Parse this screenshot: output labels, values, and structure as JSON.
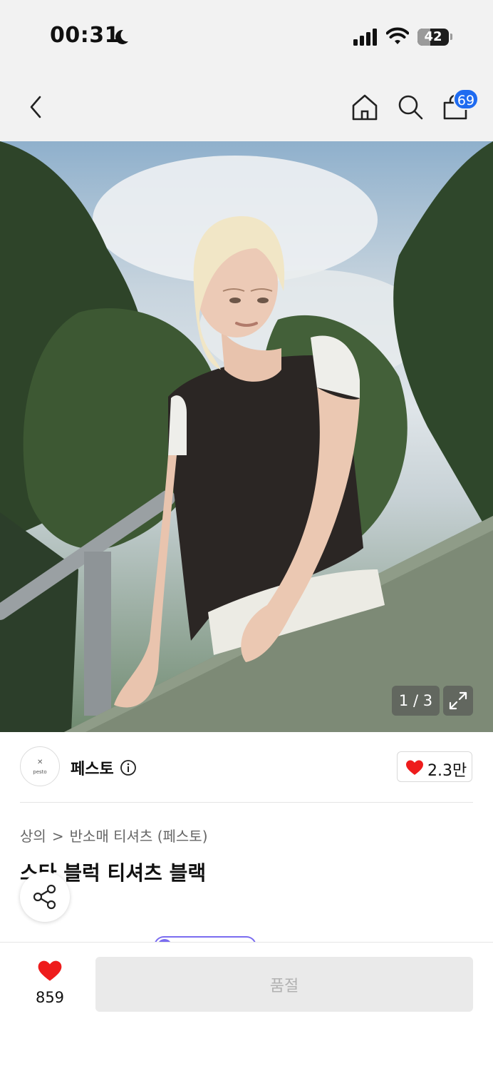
{
  "status_bar": {
    "time": "00:31",
    "battery": "42",
    "battery_level": 0.42
  },
  "header": {
    "icons": [
      "back-icon",
      "home-icon",
      "search-icon",
      "cart-icon"
    ],
    "cart_count": "69"
  },
  "gallery": {
    "counter": "1 / 3"
  },
  "brand": {
    "logo_text": "pesto",
    "name": "페스토",
    "likes": "2.3만"
  },
  "product": {
    "breadcrumb": [
      "상의",
      "반소매 티셔츠 (페스토)"
    ],
    "title": "스타 블럭 티셔츠 블랙"
  },
  "bottom_bar": {
    "wish_count": "859",
    "buy_label": "품절"
  },
  "colors": {
    "accent": "#1f6bf0",
    "heart": "#ee1c1c",
    "disabled_bg": "#eaeaea",
    "disabled_text": "#b2b2b2"
  }
}
